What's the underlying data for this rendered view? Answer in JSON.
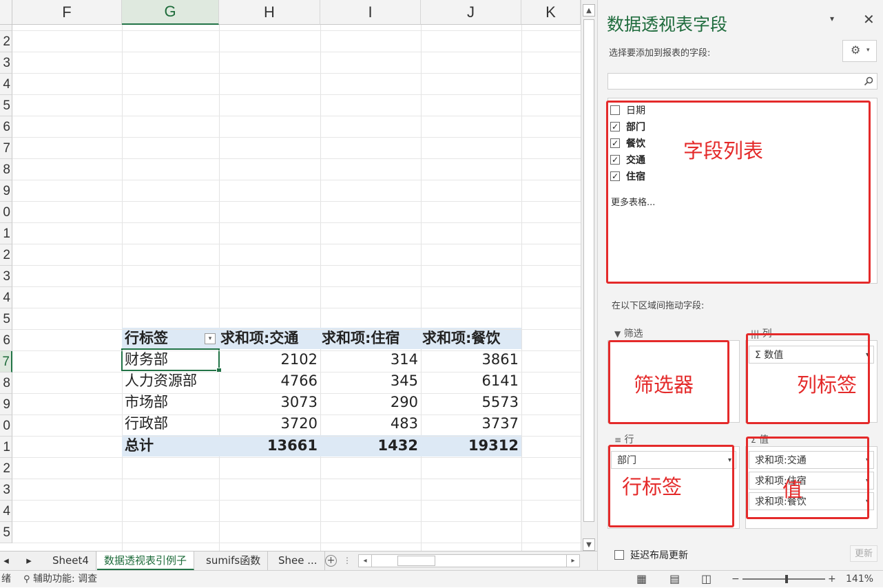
{
  "spreadsheet": {
    "columns": [
      {
        "letter": "F"
      },
      {
        "letter": "G"
      },
      {
        "letter": "H"
      },
      {
        "letter": "I"
      },
      {
        "letter": "J"
      },
      {
        "letter": "K"
      }
    ],
    "row_numbers": [
      "",
      "2",
      "3",
      "4",
      "5",
      "6",
      "7",
      "8",
      "9",
      "0",
      "1",
      "2",
      "3",
      "4",
      "5",
      "6",
      "7",
      "8",
      "9",
      "0",
      "1",
      "2",
      "3",
      "4",
      "5"
    ],
    "pivot": {
      "headers": [
        "行标签",
        "求和项:交通",
        "求和项:住宿",
        "求和项:餐饮"
      ],
      "rows": [
        [
          "财务部",
          "2102",
          "314",
          "3861"
        ],
        [
          "人力资源部",
          "4766",
          "345",
          "6141"
        ],
        [
          "市场部",
          "3073",
          "290",
          "5573"
        ],
        [
          "行政部",
          "3720",
          "483",
          "3737"
        ]
      ],
      "total": [
        "总计",
        "13661",
        "1432",
        "19312"
      ]
    }
  },
  "tabs": {
    "items": [
      "Sheet4",
      "数据透视表引例子",
      "sumifs函数",
      "Shee ..."
    ],
    "active_index": 1
  },
  "status": {
    "left": "绪",
    "accessibility": "辅助功能: 调查",
    "zoom": "141%"
  },
  "panel": {
    "title": "数据透视表字段",
    "choose_label": "选择要添加到报表的字段:",
    "search_placeholder": "",
    "fields": [
      {
        "label": "日期",
        "checked": false
      },
      {
        "label": "部门",
        "checked": true
      },
      {
        "label": "餐饮",
        "checked": true
      },
      {
        "label": "交通",
        "checked": true
      },
      {
        "label": "住宿",
        "checked": true
      }
    ],
    "more_tables": "更多表格...",
    "drag_label": "在以下区域间拖动字段:",
    "areas": {
      "filter_label": "筛选",
      "columns_label": "列",
      "rows_label": "行",
      "values_label": "值",
      "columns_items": [
        "Σ 数值"
      ],
      "rows_items": [
        "部门"
      ],
      "values_items": [
        "求和项:交通",
        "求和项:住宿",
        "求和项:餐饮"
      ]
    },
    "defer_label": "延迟布局更新",
    "update_label": "更新"
  },
  "annotations": {
    "field_list": "字段列表",
    "filter": "筛选器",
    "columns": "列标签",
    "rows": "行标签",
    "values": "值",
    "color": "#e42a2a"
  },
  "colors": {
    "accent": "#217346",
    "pivot_header_band": "#dde9f5"
  }
}
